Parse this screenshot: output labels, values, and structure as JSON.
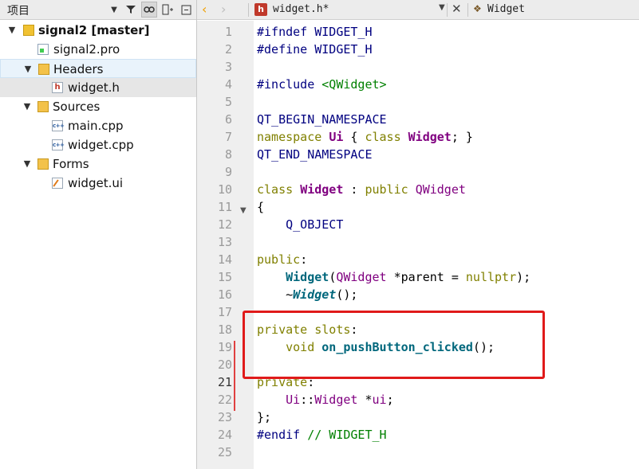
{
  "left_panel": {
    "title": "项目",
    "tree": [
      {
        "label": "signal2 [master]",
        "icon": "project-icon",
        "level": 0,
        "expanded": true,
        "bold": true
      },
      {
        "label": "signal2.pro",
        "icon": "pro-file-icon",
        "level": 1
      },
      {
        "label": "Headers",
        "icon": "headers-folder-icon",
        "level": 1,
        "expanded": true
      },
      {
        "label": "widget.h",
        "icon": "header-file-icon",
        "level": 2,
        "selected": true
      },
      {
        "label": "Sources",
        "icon": "sources-folder-icon",
        "level": 1,
        "expanded": true
      },
      {
        "label": "main.cpp",
        "icon": "cpp-file-icon",
        "level": 2
      },
      {
        "label": "widget.cpp",
        "icon": "cpp-file-icon",
        "level": 2
      },
      {
        "label": "Forms",
        "icon": "forms-folder-icon",
        "level": 1,
        "expanded": true
      },
      {
        "label": "widget.ui",
        "icon": "ui-file-icon",
        "level": 2
      }
    ]
  },
  "editor": {
    "file_name": "widget.h*",
    "symbol": "Widget",
    "current_line": 21,
    "line_numbers": [
      "1",
      "2",
      "3",
      "4",
      "5",
      "6",
      "7",
      "8",
      "9",
      "10",
      "11",
      "12",
      "13",
      "14",
      "15",
      "16",
      "17",
      "18",
      "19",
      "20",
      "21",
      "22",
      "23",
      "24",
      "25"
    ],
    "code": {
      "l1_pp": "#ifndef WIDGET_H",
      "l2_pp": "#define WIDGET_H",
      "l4_pp": "#include ",
      "l4_inc": "<QWidget>",
      "l6_mac": "QT_BEGIN_NAMESPACE",
      "l7_kw": "namespace",
      "l7_ns": "Ui",
      "l7_b": " { ",
      "l7_kw2": "class",
      "l7_cls": "Widget",
      "l7_e": "; }",
      "l8_mac": "QT_END_NAMESPACE",
      "l10_kw": "class",
      "l10_cls": "Widget",
      "l10_c": " : ",
      "l10_kw2": "public",
      "l10_base": "QWidget",
      "l11": "{",
      "l12_mac": "Q_OBJECT",
      "l14_kw": "public",
      "l14_c": ":",
      "l15_fn": "Widget",
      "l15_a": "(",
      "l15_ty": "QWidget",
      "l15_b": " *parent = ",
      "l15_kw": "nullptr",
      "l15_c": ");",
      "l16_t": "~",
      "l16_fn": "Widget",
      "l16_c": "();",
      "l18_kw": "private slots",
      "l18_c": ":",
      "l19_kw": "void",
      "l19_fn": "on_pushButton_clicked",
      "l19_c": "();",
      "l21_kw": "private",
      "l21_c": ":",
      "l22_ns": "Ui",
      "l22_a": "::",
      "l22_ty": "Widget",
      "l22_b": " *",
      "l22_var": "ui",
      "l22_c": ";",
      "l23": "};",
      "l24_pp": "#endif",
      "l24_cm": " // WIDGET_H"
    }
  },
  "annotation": {
    "color": "#e01a1a"
  }
}
